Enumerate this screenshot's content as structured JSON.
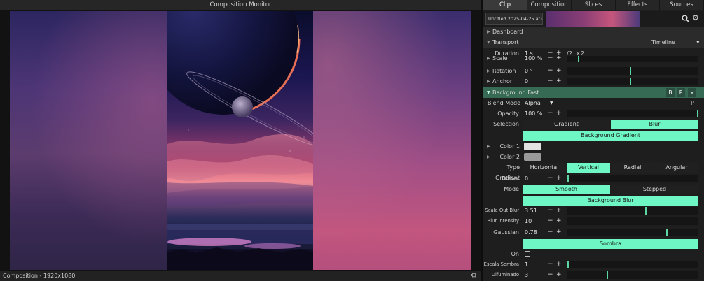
{
  "monitor": {
    "title": "Composition Monitor",
    "footer_text": "Composition - 1920x1080"
  },
  "tabs": [
    "Clip",
    "Composition",
    "Slices",
    "Effects",
    "Sources"
  ],
  "clip": {
    "name": "Untitled 2025-04-25 at 01.3..."
  },
  "sections": {
    "dashboard": "Dashboard",
    "transport": "Transport",
    "transport_mode": "Timeline",
    "background_fast": "Background Fast",
    "bg_buttons": [
      "B",
      "P",
      "×"
    ]
  },
  "duration": {
    "label": "Duration",
    "value": "1 s",
    "minus": "−",
    "plus": "+",
    "half": "/2",
    "double": "×2"
  },
  "transform": {
    "scale": {
      "label": "Scale",
      "value": "100 %",
      "level": 0.08
    },
    "rotation": {
      "label": "Rotation",
      "value": "0 °",
      "level": 0.48
    },
    "anchor": {
      "label": "Anchor",
      "value": "0",
      "level": 0.48
    }
  },
  "blend": {
    "label": "Blend Mode",
    "value": "Alpha",
    "param_btn": "P"
  },
  "opacity": {
    "label": "Opacity",
    "value": "100 %",
    "level": 1.0
  },
  "selection": {
    "label": "Selection",
    "options": [
      "Gradient",
      "Blur"
    ],
    "active": 1
  },
  "bg_gradient_label": "Background Gradient",
  "colors": {
    "color1": {
      "label": "Color 1",
      "hex": "#e2e2e2"
    },
    "color2": {
      "label": "Color 2",
      "hex": "#9a9a9a"
    }
  },
  "type_gradient": {
    "label": "Type Gradient",
    "options": [
      "Horizontal",
      "Vertical",
      "Radial",
      "Angular"
    ],
    "active": 1
  },
  "dither": {
    "label": "Dither",
    "value": "0",
    "level": 0.0
  },
  "mode": {
    "label": "Mode",
    "options": [
      "Smooth",
      "Stepped"
    ],
    "active": 0
  },
  "bg_blur_label": "Background Blur",
  "blur": {
    "scale_out": {
      "label": "Scale Out Blur",
      "value": "3.51",
      "level": 0.6
    },
    "intensity": {
      "label": "Blur Intensity",
      "value": "10",
      "level": 0.0
    },
    "gaussian": {
      "label": "Gaussian",
      "value": "0.78",
      "level": 0.76
    }
  },
  "sombra_label": "Sombra",
  "on": {
    "label": "On"
  },
  "escala_sombra": {
    "label": "Escala Sombra",
    "value": "1",
    "level": 0.0
  },
  "difuminado": {
    "label": "Difuminado",
    "value": "3",
    "level": 0.3
  },
  "accent_color": "#6ef7c4",
  "section_green": "#366a54"
}
